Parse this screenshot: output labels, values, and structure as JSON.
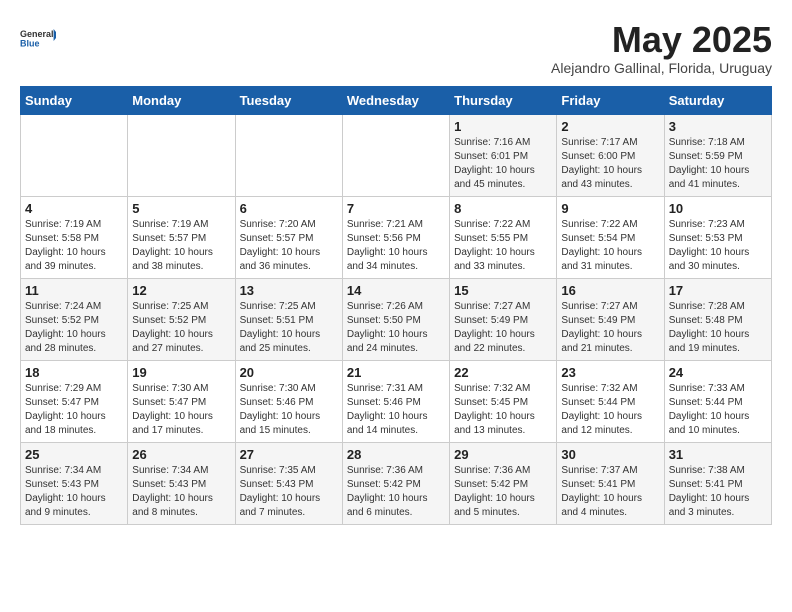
{
  "logo": {
    "general": "General",
    "blue": "Blue"
  },
  "title": "May 2025",
  "subtitle": "Alejandro Gallinal, Florida, Uruguay",
  "weekdays": [
    "Sunday",
    "Monday",
    "Tuesday",
    "Wednesday",
    "Thursday",
    "Friday",
    "Saturday"
  ],
  "weeks": [
    [
      {
        "day": "",
        "info": ""
      },
      {
        "day": "",
        "info": ""
      },
      {
        "day": "",
        "info": ""
      },
      {
        "day": "",
        "info": ""
      },
      {
        "day": "1",
        "info": "Sunrise: 7:16 AM\nSunset: 6:01 PM\nDaylight: 10 hours\nand 45 minutes."
      },
      {
        "day": "2",
        "info": "Sunrise: 7:17 AM\nSunset: 6:00 PM\nDaylight: 10 hours\nand 43 minutes."
      },
      {
        "day": "3",
        "info": "Sunrise: 7:18 AM\nSunset: 5:59 PM\nDaylight: 10 hours\nand 41 minutes."
      }
    ],
    [
      {
        "day": "4",
        "info": "Sunrise: 7:19 AM\nSunset: 5:58 PM\nDaylight: 10 hours\nand 39 minutes."
      },
      {
        "day": "5",
        "info": "Sunrise: 7:19 AM\nSunset: 5:57 PM\nDaylight: 10 hours\nand 38 minutes."
      },
      {
        "day": "6",
        "info": "Sunrise: 7:20 AM\nSunset: 5:57 PM\nDaylight: 10 hours\nand 36 minutes."
      },
      {
        "day": "7",
        "info": "Sunrise: 7:21 AM\nSunset: 5:56 PM\nDaylight: 10 hours\nand 34 minutes."
      },
      {
        "day": "8",
        "info": "Sunrise: 7:22 AM\nSunset: 5:55 PM\nDaylight: 10 hours\nand 33 minutes."
      },
      {
        "day": "9",
        "info": "Sunrise: 7:22 AM\nSunset: 5:54 PM\nDaylight: 10 hours\nand 31 minutes."
      },
      {
        "day": "10",
        "info": "Sunrise: 7:23 AM\nSunset: 5:53 PM\nDaylight: 10 hours\nand 30 minutes."
      }
    ],
    [
      {
        "day": "11",
        "info": "Sunrise: 7:24 AM\nSunset: 5:52 PM\nDaylight: 10 hours\nand 28 minutes."
      },
      {
        "day": "12",
        "info": "Sunrise: 7:25 AM\nSunset: 5:52 PM\nDaylight: 10 hours\nand 27 minutes."
      },
      {
        "day": "13",
        "info": "Sunrise: 7:25 AM\nSunset: 5:51 PM\nDaylight: 10 hours\nand 25 minutes."
      },
      {
        "day": "14",
        "info": "Sunrise: 7:26 AM\nSunset: 5:50 PM\nDaylight: 10 hours\nand 24 minutes."
      },
      {
        "day": "15",
        "info": "Sunrise: 7:27 AM\nSunset: 5:49 PM\nDaylight: 10 hours\nand 22 minutes."
      },
      {
        "day": "16",
        "info": "Sunrise: 7:27 AM\nSunset: 5:49 PM\nDaylight: 10 hours\nand 21 minutes."
      },
      {
        "day": "17",
        "info": "Sunrise: 7:28 AM\nSunset: 5:48 PM\nDaylight: 10 hours\nand 19 minutes."
      }
    ],
    [
      {
        "day": "18",
        "info": "Sunrise: 7:29 AM\nSunset: 5:47 PM\nDaylight: 10 hours\nand 18 minutes."
      },
      {
        "day": "19",
        "info": "Sunrise: 7:30 AM\nSunset: 5:47 PM\nDaylight: 10 hours\nand 17 minutes."
      },
      {
        "day": "20",
        "info": "Sunrise: 7:30 AM\nSunset: 5:46 PM\nDaylight: 10 hours\nand 15 minutes."
      },
      {
        "day": "21",
        "info": "Sunrise: 7:31 AM\nSunset: 5:46 PM\nDaylight: 10 hours\nand 14 minutes."
      },
      {
        "day": "22",
        "info": "Sunrise: 7:32 AM\nSunset: 5:45 PM\nDaylight: 10 hours\nand 13 minutes."
      },
      {
        "day": "23",
        "info": "Sunrise: 7:32 AM\nSunset: 5:44 PM\nDaylight: 10 hours\nand 12 minutes."
      },
      {
        "day": "24",
        "info": "Sunrise: 7:33 AM\nSunset: 5:44 PM\nDaylight: 10 hours\nand 10 minutes."
      }
    ],
    [
      {
        "day": "25",
        "info": "Sunrise: 7:34 AM\nSunset: 5:43 PM\nDaylight: 10 hours\nand 9 minutes."
      },
      {
        "day": "26",
        "info": "Sunrise: 7:34 AM\nSunset: 5:43 PM\nDaylight: 10 hours\nand 8 minutes."
      },
      {
        "day": "27",
        "info": "Sunrise: 7:35 AM\nSunset: 5:43 PM\nDaylight: 10 hours\nand 7 minutes."
      },
      {
        "day": "28",
        "info": "Sunrise: 7:36 AM\nSunset: 5:42 PM\nDaylight: 10 hours\nand 6 minutes."
      },
      {
        "day": "29",
        "info": "Sunrise: 7:36 AM\nSunset: 5:42 PM\nDaylight: 10 hours\nand 5 minutes."
      },
      {
        "day": "30",
        "info": "Sunrise: 7:37 AM\nSunset: 5:41 PM\nDaylight: 10 hours\nand 4 minutes."
      },
      {
        "day": "31",
        "info": "Sunrise: 7:38 AM\nSunset: 5:41 PM\nDaylight: 10 hours\nand 3 minutes."
      }
    ]
  ]
}
